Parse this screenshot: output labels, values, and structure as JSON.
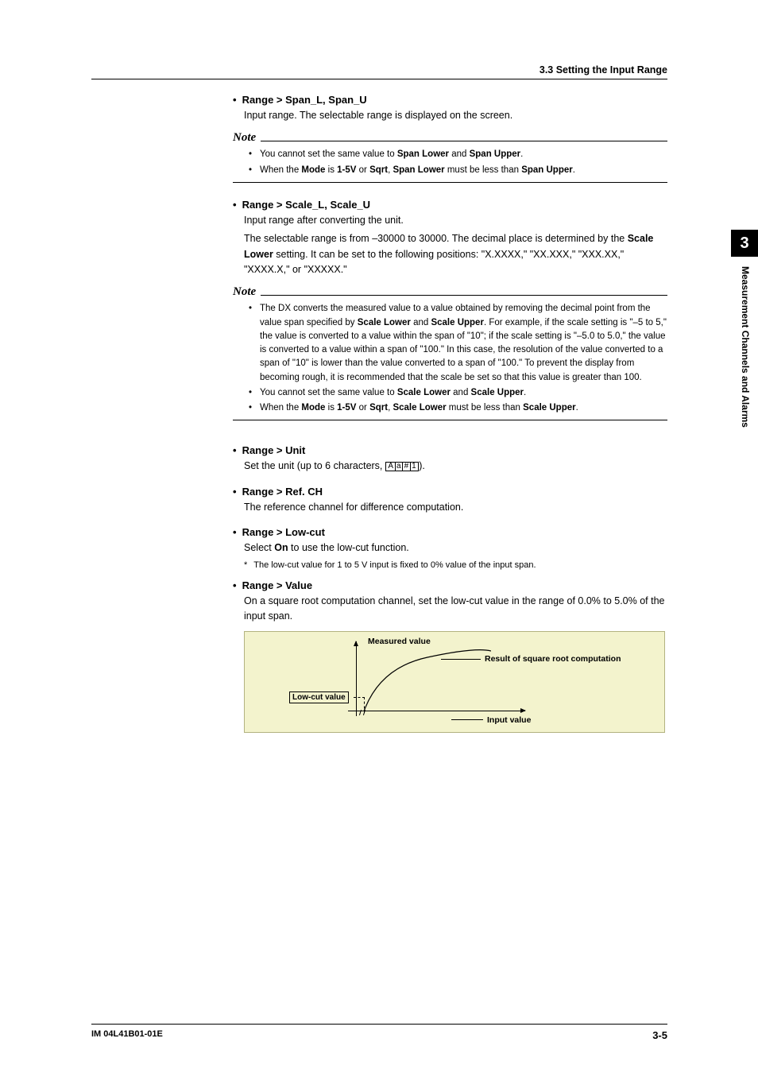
{
  "header": {
    "section": "3.3  Setting the Input Range"
  },
  "sidetab": {
    "number": "3",
    "label": "Measurement Channels and Alarms"
  },
  "sec1": {
    "heading": "Range > Span_L, Span_U",
    "body": "Input range. The selectable range is displayed on the screen.",
    "note_label": "Note",
    "notes": {
      "n1_a": "You cannot set the same value to ",
      "n1_b": "Span Lower",
      "n1_c": " and ",
      "n1_d": "Span Upper",
      "n1_e": ".",
      "n2_a": "When the ",
      "n2_b": "Mode",
      "n2_c": " is ",
      "n2_d": "1-5V",
      "n2_e": " or ",
      "n2_f": "Sqrt",
      "n2_g": ", ",
      "n2_h": "Span Lower",
      "n2_i": " must be less than ",
      "n2_j": "Span Upper",
      "n2_k": "."
    }
  },
  "sec2": {
    "heading": "Range > Scale_L, Scale_U",
    "body1": "Input range after converting the unit.",
    "body2_a": "The selectable range is from –30000 to 30000. The decimal place is determined by the ",
    "body2_b": "Scale Lower",
    "body2_c": " setting. It can be set to the following positions: \"X.XXXX,\" \"XX.XXX,\" \"XXX.XX,\" \"XXXX.X,\" or \"XXXXX.\"",
    "note_label": "Note",
    "notes": {
      "n1_a": "The DX converts the measured value to a value obtained by removing the decimal point from the value span specified by ",
      "n1_b": "Scale Lower",
      "n1_c": " and ",
      "n1_d": "Scale Upper",
      "n1_e": ". For example, if the scale setting is \"–5 to 5,\" the value is converted to a value within the span of \"10\"; if the scale setting is \"–5.0 to 5.0,\" the value is converted to a value within a span of \"100.\" In this case, the resolution of the value converted to a span of \"10\" is lower than the value converted to a span of \"100.\" To prevent the display from becoming rough, it is recommended that the scale be set so that this value is greater than 100.",
      "n2_a": "You cannot set the same value to ",
      "n2_b": "Scale Lower",
      "n2_c": " and ",
      "n2_d": "Scale Upper",
      "n2_e": ".",
      "n3_a": "When the ",
      "n3_b": "Mode",
      "n3_c": " is ",
      "n3_d": "1-5V",
      "n3_e": " or ",
      "n3_f": "Sqrt",
      "n3_g": ", ",
      "n3_h": "Scale Lower",
      "n3_i": " must be less than ",
      "n3_j": "Scale Upper",
      "n3_k": "."
    }
  },
  "sec3": {
    "heading": "Range > Unit",
    "body_a": "Set the unit (up to 6 characters,   ",
    "body_b": ").",
    "keycap": {
      "k1": "A",
      "k2": "a",
      "k3": "#",
      "k4": "1"
    }
  },
  "sec4": {
    "heading": "Range > Ref. CH",
    "body": "The reference channel for difference computation."
  },
  "sec5": {
    "heading": "Range > Low-cut",
    "body_a": "Select ",
    "body_b": "On",
    "body_c": " to use the low-cut function.",
    "footnote": "The low-cut value for 1 to 5 V input is fixed to 0% value of the input span."
  },
  "sec6": {
    "heading": "Range > Value",
    "body": "On a square root computation channel, set the low-cut value in the range of 0.0% to 5.0% of the input span."
  },
  "diagram": {
    "measured": "Measured value",
    "result": "Result of square root computation",
    "lowcut": "Low-cut value",
    "input": "Input value"
  },
  "footer": {
    "doc": "IM 04L41B01-01E",
    "page": "3-5"
  }
}
